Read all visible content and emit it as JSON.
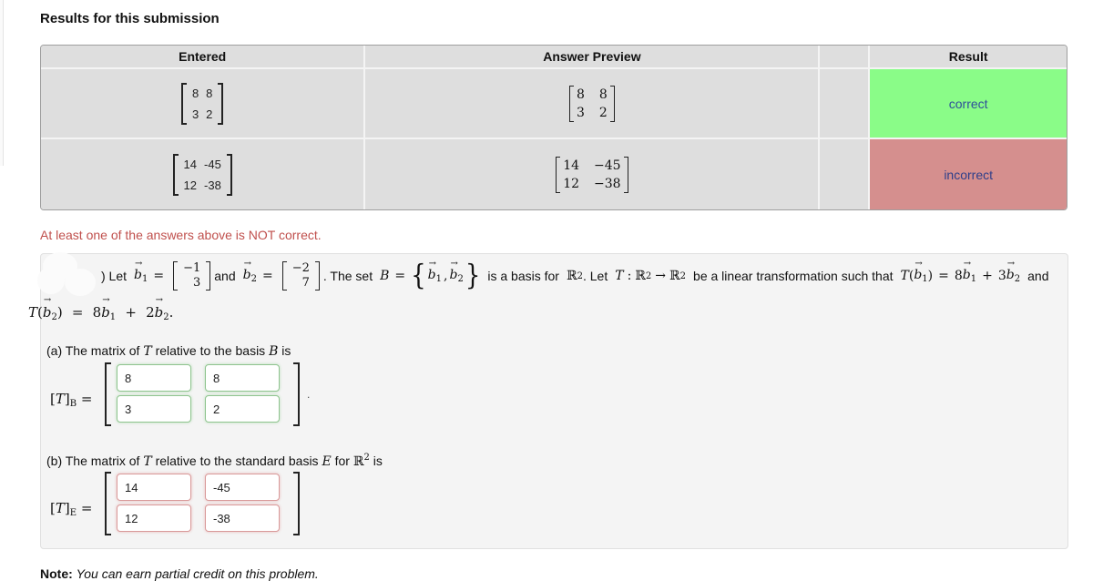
{
  "results": {
    "title": "Results for this submission",
    "headers": [
      "Entered",
      "Answer Preview",
      "",
      "Result"
    ],
    "rows": [
      {
        "entered": [
          [
            "8",
            "8"
          ],
          [
            "3",
            "2"
          ]
        ],
        "preview": [
          [
            "8",
            "8"
          ],
          [
            "3",
            "2"
          ]
        ],
        "result": "correct",
        "result_color": "#8afc88"
      },
      {
        "entered": [
          [
            "14",
            "-45"
          ],
          [
            "12",
            "-38"
          ]
        ],
        "preview": [
          [
            "14",
            "−45"
          ],
          [
            "12",
            "−38"
          ]
        ],
        "result": "incorrect",
        "result_color": "#d58f8e"
      }
    ]
  },
  "warning": "At least one of the answers above is NOT correct.",
  "problem": {
    "intro_prefix": ") Let",
    "b1_label": "b",
    "b1_sub": "1",
    "b1_vector": [
      "−1",
      "3"
    ],
    "and": "and",
    "b2_label": "b",
    "b2_sub": "2",
    "b2_vector": [
      "−2",
      "7"
    ],
    "set_text": ". The set",
    "set_name": "B",
    "basis_text": "is a basis for",
    "reals": "ℝ",
    "exp": "2",
    "let_t": ". Let",
    "t_name": "T",
    "linear_text": "be a linear transformation such that",
    "t_b1_rhs": "8b₁ + 3b₂",
    "t_b1_c1": "8",
    "t_b1_c2": "3",
    "and_end": "and",
    "t_b2_c1": "8",
    "t_b2_c2": "2",
    "part_a": {
      "label_prefix": "(a) The matrix of",
      "label_mid": "relative to the basis",
      "label_suffix": "is",
      "basis": "B",
      "lhs_sub": "B",
      "values": [
        "8",
        "8",
        "3",
        "2"
      ],
      "status": "correct"
    },
    "part_b": {
      "label_prefix": "(b) The matrix of",
      "label_mid": "relative to the standard basis",
      "label_for": "for",
      "label_suffix": "is",
      "basis": "E",
      "lhs_sub": "E",
      "values": [
        "14",
        "-45",
        "12",
        "-38"
      ],
      "status": "incorrect"
    }
  },
  "note": {
    "bold": "Note:",
    "text": "You can earn partial credit on this problem."
  }
}
